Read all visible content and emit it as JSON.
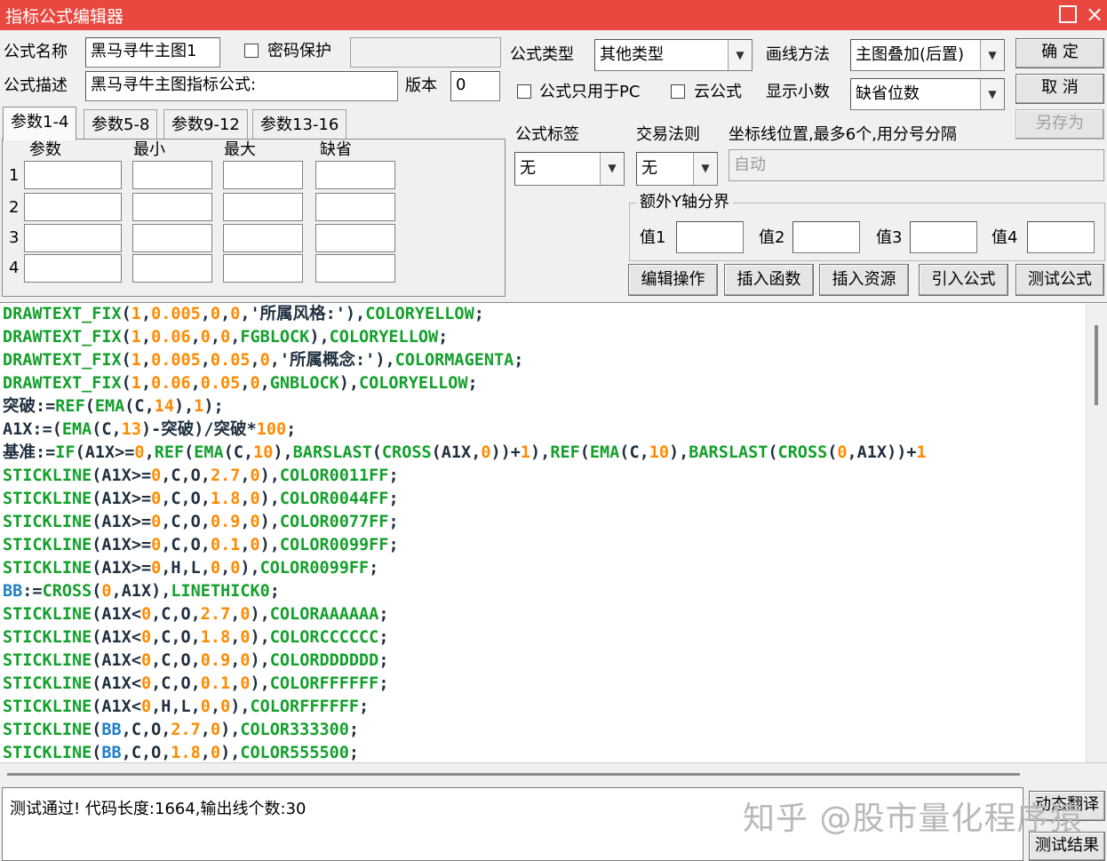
{
  "window": {
    "title": "指标公式编辑器",
    "close_glyph": "×"
  },
  "form": {
    "name_label": "公式名称",
    "name_value": "黑马寻牛主图1",
    "password_label": "密码保护",
    "desc_label": "公式描述",
    "desc_value": "黑马寻牛主图指标公式:",
    "version_label": "版本",
    "version_value": "0",
    "type_label": "公式类型",
    "type_value": "其他类型",
    "draw_label": "画线方法",
    "draw_value": "主图叠加(后置)",
    "pc_only_label": "公式只用于PC",
    "cloud_label": "云公式",
    "decimal_label": "显示小数",
    "decimal_value": "缺省位数",
    "tag_label": "公式标签",
    "tag_value": "无",
    "rule_label": "交易法则",
    "rule_value": "无",
    "coord_label": "坐标线位置,最多6个,用分号分隔",
    "coord_placeholder": "自动",
    "yaxis_group_label": "额外Y轴分界",
    "yaxis_values": [
      "值1",
      "值2",
      "值3",
      "值4"
    ]
  },
  "buttons": {
    "ok": "确  定",
    "cancel": "取  消",
    "save_as": "另存为",
    "edit": "编辑操作",
    "insert_func": "插入函数",
    "insert_res": "插入资源",
    "import": "引入公式",
    "test": "测试公式",
    "translate": "动态翻译",
    "test_result": "测试结果"
  },
  "tabs": [
    "参数1-4",
    "参数5-8",
    "参数9-12",
    "参数13-16"
  ],
  "params": {
    "headers": [
      "参数",
      "最小",
      "最大",
      "缺省"
    ],
    "rows": [
      "1",
      "2",
      "3",
      "4"
    ]
  },
  "code_lines": [
    "DRAWTEXT_FIX(1,0.005,0,0,'所属风格:'),COLORYELLOW;",
    "DRAWTEXT_FIX(1,0.06,0,0,FGBLOCK),COLORYELLOW;",
    "DRAWTEXT_FIX(1,0.005,0.05,0,'所属概念:'),COLORMAGENTA;",
    "DRAWTEXT_FIX(1,0.06,0.05,0,GNBLOCK),COLORYELLOW;",
    "突破:=REF(EMA(C,14),1);",
    "A1X:=(EMA(C,13)-突破)/突破*100;",
    "基准:=IF(A1X>=0,REF(EMA(C,10),BARSLAST(CROSS(A1X,0))+1),REF(EMA(C,10),BARSLAST(CROSS(0,A1X))+1",
    "STICKLINE(A1X>=0,C,O,2.7,0),COLOR0011FF;",
    "STICKLINE(A1X>=0,C,O,1.8,0),COLOR0044FF;",
    "STICKLINE(A1X>=0,C,O,0.9,0),COLOR0077FF;",
    "STICKLINE(A1X>=0,C,O,0.1,0),COLOR0099FF;",
    "STICKLINE(A1X>=0,H,L,0,0),COLOR0099FF;",
    "BB:=CROSS(0,A1X),LINETHICK0;",
    "STICKLINE(A1X<0,C,O,2.7,0),COLORAAAAAA;",
    "STICKLINE(A1X<0,C,O,1.8,0),COLORCCCCCC;",
    "STICKLINE(A1X<0,C,O,0.9,0),COLORDDDDDD;",
    "STICKLINE(A1X<0,C,O,0.1,0),COLORFFFFFF;",
    "STICKLINE(A1X<0,H,L,0,0),COLORFFFFFF;",
    "STICKLINE(BB,C,O,2.7,0),COLOR333300;",
    "STICKLINE(BB,C,O,1.8,0),COLOR555500;"
  ],
  "status": {
    "text": "测试通过! 代码长度:1664,输出线个数:30"
  },
  "watermark": "知乎 @股市量化程序猿",
  "colors": {
    "titlebar": "#e8483f",
    "func": "#14a02c",
    "number": "#ff8a00",
    "variable": "#1e7fc8"
  }
}
